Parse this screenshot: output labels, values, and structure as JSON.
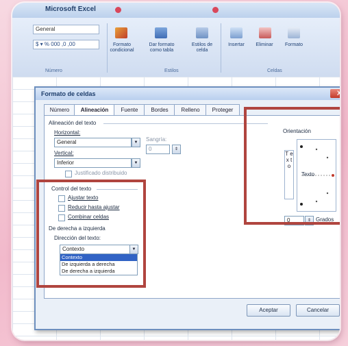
{
  "app": {
    "title": "Microsoft Excel"
  },
  "ribbon": {
    "font_name": "General",
    "number_format_label": "Número",
    "buttons": [
      {
        "label": "Formato condicional"
      },
      {
        "label": "Dar formato como tabla"
      },
      {
        "label": "Estilos de celda"
      },
      {
        "label": "Insertar"
      },
      {
        "label": "Eliminar"
      },
      {
        "label": "Formato"
      }
    ],
    "groups": {
      "number": "Número",
      "styles": "Estilos",
      "cells": "Celdas"
    }
  },
  "dialog": {
    "title": "Formato de celdas",
    "close_label": "X",
    "tabs": [
      "Número",
      "Alineación",
      "Fuente",
      "Bordes",
      "Relleno",
      "Proteger"
    ],
    "alignment_section": "Alineación del texto",
    "horizontal_label": "Horizontal:",
    "horizontal_value": "General",
    "vertical_label": "Vertical:",
    "vertical_value": "Inferior",
    "indent_label": "Sangría:",
    "indent_value": "0",
    "distributed_label": "Justificado distribuido",
    "control_section": "Control del texto",
    "wrap_text": "Ajustar texto",
    "shrink_to_fit": "Reducir hasta ajustar",
    "merge_cells": "Combinar celdas",
    "rtl_section": "De derecha a izquierda",
    "text_direction_label": "Dirección del texto:",
    "text_direction_value": "Contexto",
    "text_direction_options": [
      "Contexto",
      "De izquierda a derecha",
      "De derecha a izquierda"
    ],
    "orientation_label": "Orientación",
    "vertical_text": "T e x t o",
    "dial_text": "Texto",
    "degrees_value": "0",
    "degrees_label": "Grados",
    "ok_button": "Aceptar",
    "cancel_button": "Cancelar"
  },
  "highlight_color": "#b0453f"
}
